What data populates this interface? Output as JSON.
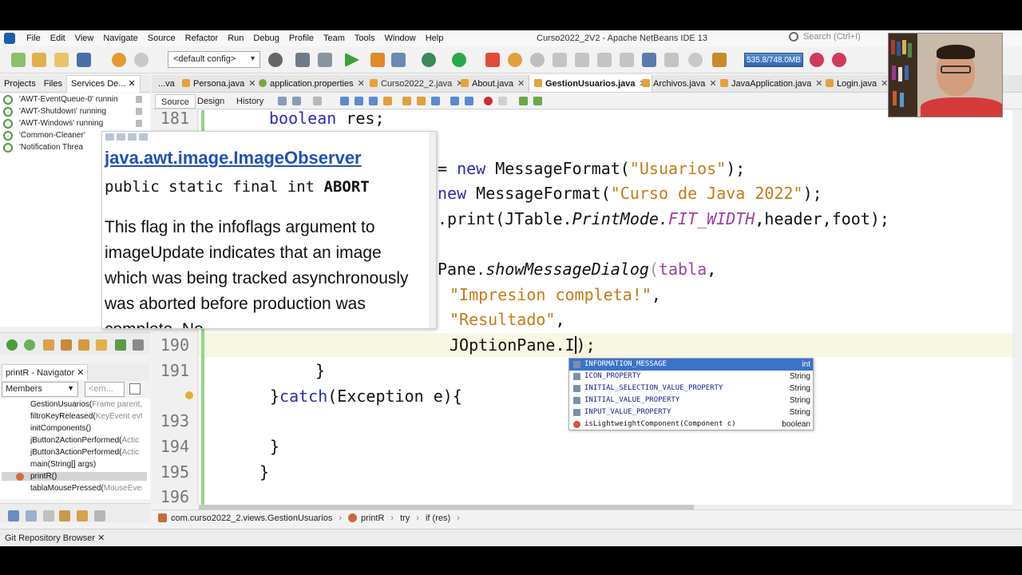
{
  "window": {
    "title": "Curso2022_2V2 - Apache NetBeans IDE 13",
    "menus": [
      "File",
      "Edit",
      "View",
      "Navigate",
      "Source",
      "Refactor",
      "Run",
      "Debug",
      "Profile",
      "Team",
      "Tools",
      "Window",
      "Help"
    ],
    "search_placeholder": "Search (Ctrl+I)"
  },
  "toolbar": {
    "config": "<default config>",
    "memory": "535.8/748.0MB"
  },
  "left_panel": {
    "tabs": [
      "Projects",
      "Files",
      "Services De..."
    ],
    "threads": [
      "'AWT-EventQueue-0' runnin",
      "'AWT-Shutdown' running",
      "'AWT-Windows' running",
      "'Common-Cleaner'",
      "'Notification Threa"
    ]
  },
  "navigator": {
    "tab": "printR - Navigator",
    "filter": "Members",
    "filter2": "<em...",
    "members": [
      {
        "name": "GestionUsuarios(",
        "type": "Frame parent,"
      },
      {
        "name": "filtroKeyReleased(",
        "type": "KeyEvent evt"
      },
      {
        "name": "initComponents()",
        "type": ""
      },
      {
        "name": "jButton2ActionPerformed(",
        "type": "Actic"
      },
      {
        "name": "jButton3ActionPerformed(",
        "type": "Actic"
      },
      {
        "name": "main(String[] args)",
        "type": ""
      },
      {
        "name": "printR()",
        "type": ""
      },
      {
        "name": "tablaMousePressed(",
        "type": "MouseEver"
      }
    ]
  },
  "editor": {
    "tabs": [
      {
        "label": "...va"
      },
      {
        "label": "Persona.java"
      },
      {
        "label": "application.properties"
      },
      {
        "label": "Curso2022_2.java"
      },
      {
        "label": "About.java"
      },
      {
        "label": "GestionUsuarios.java",
        "active": true
      },
      {
        "label": "Archivos.java"
      },
      {
        "label": "JavaApplication.java"
      },
      {
        "label": "Login.java"
      }
    ],
    "views": [
      "Source",
      "Design",
      "History"
    ],
    "line_numbers": [
      "181",
      "190",
      "191",
      "193",
      "194",
      "195",
      "196"
    ],
    "code": {
      "l181_kw": "boolean",
      "l181_rest": " res;",
      "l_a_op": "= ",
      "l_a_kw": "new",
      "l_a_cls": " MessageFormat(",
      "l_a_str": "\"Usuarios\"",
      "l_a_end": ");",
      "l_b_kw": "new",
      "l_b_cls": " MessageFormat(",
      "l_b_str": "\"Curso de Java 2022\"",
      "l_b_end": ");",
      "l_c_pre": ".print(JTable.",
      "l_c_it": "PrintMode.",
      "l_c_fld": "FIT_WIDTH",
      "l_c_end": ",header,foot);",
      "l_d_pre": "Pane.",
      "l_d_it": "showMessageDialog",
      "l_d_par": "(",
      "l_d_arg": "tabla",
      "l_d_end": ",",
      "l_e_str": "\"Impresion completa!\"",
      "l_e_end": ",",
      "l_f_str": "\"Resultado\"",
      "l_f_end": ",",
      "l190_pre": "JOptionPane.I",
      "l190_post": ");",
      "l191": "}",
      "l192_close": "}",
      "l192_kw": "catch",
      "l192_rest": "(Exception e){",
      "l194": "}",
      "l195": "}"
    }
  },
  "javadoc": {
    "class": "java.awt.image.ImageObserver",
    "signature": "public static final int ",
    "signature_name": "ABORT",
    "description": "This flag in the infoflags argument to imageUpdate indicates that an image which was being tracked asynchronously was aborted before production was complete. No"
  },
  "completion": [
    {
      "name": "INFORMATION_MESSAGE",
      "type": "int",
      "selected": true
    },
    {
      "name": "ICON_PROPERTY",
      "type": "String"
    },
    {
      "name": "INITIAL_SELECTION_VALUE_PROPERTY",
      "type": "String"
    },
    {
      "name": "INITIAL_VALUE_PROPERTY",
      "type": "String"
    },
    {
      "name": "INPUT_VALUE_PROPERTY",
      "type": "String"
    },
    {
      "name": "isLightweightComponent(Component c)",
      "type": "boolean",
      "method": true
    }
  ],
  "breadcrumb": [
    "com.curso2022_2.views.GestionUsuarios",
    "printR",
    "try",
    "if (res)"
  ],
  "bottom": {
    "tab": "Git Repository Browser"
  },
  "colors": {
    "keyword": "#2c2cb6",
    "string": "#c67a14",
    "field": "#a040a0",
    "selection": "#3a73c9",
    "change_bar": "#8dd88a"
  }
}
